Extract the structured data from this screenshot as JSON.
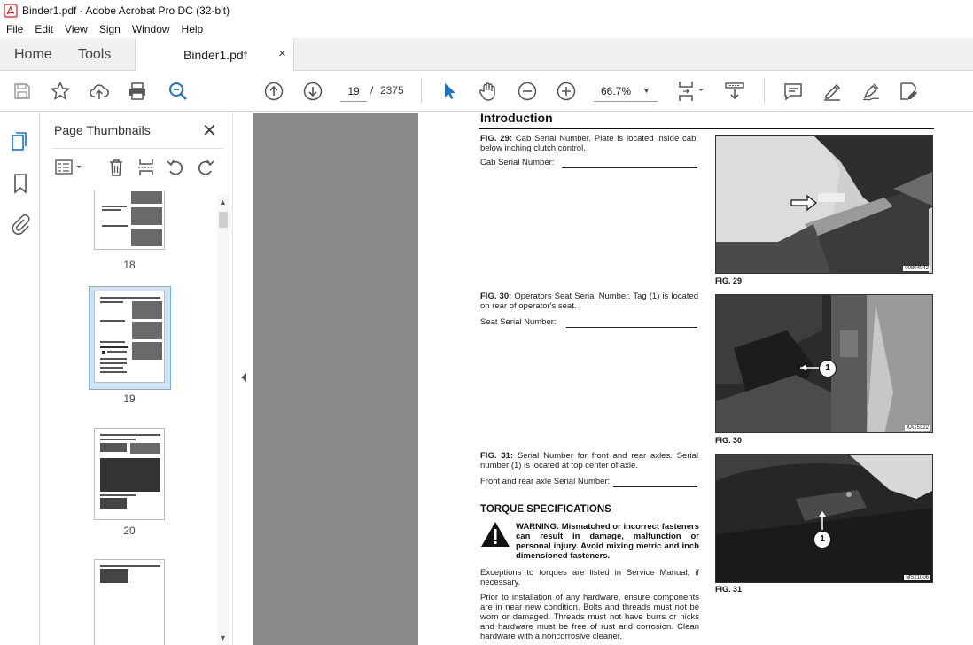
{
  "window": {
    "title": "Binder1.pdf - Adobe Acrobat Pro DC (32-bit)"
  },
  "menu": [
    "File",
    "Edit",
    "View",
    "Sign",
    "Window",
    "Help"
  ],
  "tabs": {
    "home": "Home",
    "tools": "Tools",
    "document": "Binder1.pdf",
    "close_glyph": "×"
  },
  "toolbar": {
    "current_page": "19",
    "page_separator": "/",
    "total_pages": "2375",
    "zoom": "66.7%"
  },
  "thumbnail_panel": {
    "title": "Page Thumbnails",
    "close_glyph": "✕",
    "pages": [
      "18",
      "19",
      "20"
    ],
    "selected_page": "19"
  },
  "document": {
    "heading": "Introduction",
    "fig29": {
      "caption_bold": "FIG. 29:",
      "caption": " Cab Serial Number. Plate is located inside cab, below inching clutch control.",
      "field_label": "Cab Serial Number:",
      "label": "FIG. 29",
      "code": "00804942"
    },
    "fig30": {
      "caption_bold": "FIG. 30:",
      "caption": " Operators Seat Serial Number. Tag (1) is located on rear of operator's seat.",
      "field_label": "Seat Serial Number:",
      "label": "FIG. 30",
      "code": "KA15322",
      "callout": "1"
    },
    "fig31": {
      "caption_bold": "FIG. 31:",
      "caption": " Serial Number for front and rear axles. Serial number (1) is located at top center of axle.",
      "field_label": "Front and rear axle Serial Number:",
      "label": "FIG. 31",
      "code": "MS21006",
      "callout": "1"
    },
    "torque": {
      "title": "TORQUE SPECIFICATIONS",
      "warning": "WARNING: Mismatched or incorrect fasteners can result in damage, malfunction or personal injury. Avoid mixing metric and inch dimensioned fasteners.",
      "exceptions": "Exceptions to torques are listed in Service Manual, if necessary.",
      "prior": "Prior to installation of any hardware, ensure components are in near new condition. Bolts and threads must not be worn or damaged. Threads must not have burrs or nicks and hardware must be free of rust and corrosion. Clean hardware with a noncorrosive cleaner."
    }
  },
  "colors": {
    "acrobat_red": "#d7191c",
    "toolbar_icon": "#555555",
    "selection_blue": "#1a73c7",
    "panel_bg": "#f0f0f0",
    "doc_bg": "#8a8a8a"
  }
}
